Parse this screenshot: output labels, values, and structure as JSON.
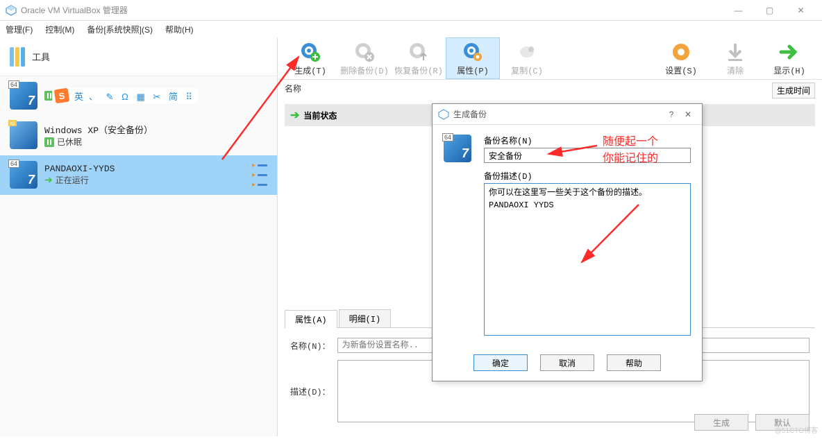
{
  "window": {
    "title": "Oracle VM VirtualBox 管理器"
  },
  "menu": {
    "file": "管理(F)",
    "control": "控制(M)",
    "backup": "备份[系统快照](S)",
    "help": "帮助(H)"
  },
  "sidebar": {
    "tools_label": "工具",
    "ime": {
      "lang": "英",
      "icons": "、 ✎ Ω ▦ ✂ 简 ⠿"
    },
    "vms": [
      {
        "name": "",
        "status": "已休眠",
        "status_kind": "paused"
      },
      {
        "name": "Windows XP（安全备份）",
        "status": "已休眠",
        "status_kind": "paused",
        "os_badge": "xp"
      },
      {
        "name": "PANDAOXI-YYDS",
        "status": "正在运行",
        "status_kind": "running",
        "selected": true
      }
    ]
  },
  "toolbar": {
    "create": "生成(T)",
    "delete": "删除备份(D)",
    "restore": "恢复备份(R)",
    "props": "属性(P)",
    "copy": "复制(C)",
    "settings": "设置(S)",
    "clear": "清除",
    "show": "显示(H)"
  },
  "columns": {
    "name": "名称",
    "time": "生成时间"
  },
  "state_row": "当前状态",
  "tabs": {
    "props": "属性(A)",
    "detail": "明细(I)"
  },
  "form": {
    "name_label": "名称(N)：",
    "name_placeholder": "为新备份设置名称..",
    "desc_label": "描述(D)："
  },
  "footer": {
    "gen": "生成",
    "default": "默认"
  },
  "dialog": {
    "title": "生成备份",
    "name_label": "备份名称(N)",
    "name_value": "安全备份",
    "desc_label": "备份描述(D)",
    "desc_value": "你可以在这里写一些关于这个备份的描述。\nPANDAOXI YYDS",
    "ok": "确定",
    "cancel": "取消",
    "help": "帮助"
  },
  "annotations": {
    "a1": "随便起一个",
    "a2": "你能记住的"
  },
  "watermark": "@51CTO博客"
}
